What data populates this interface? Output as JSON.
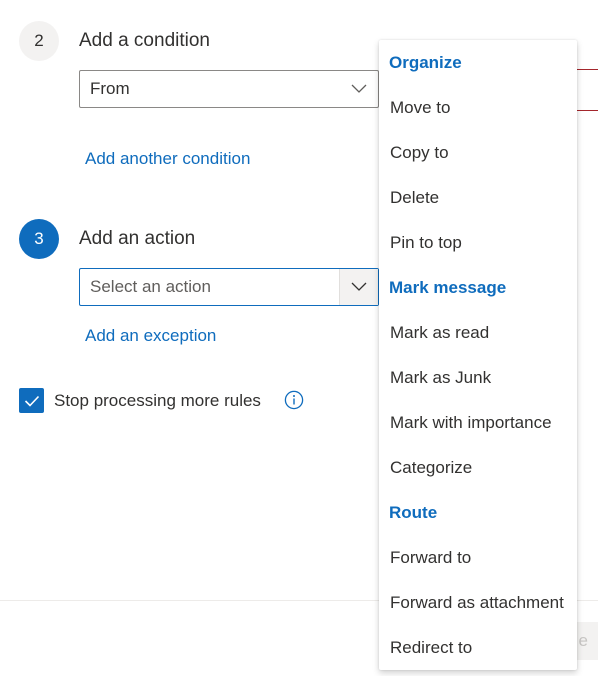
{
  "step2": {
    "number": "2",
    "title": "Add a condition",
    "dropdown_value": "From",
    "add_link": "Add another condition"
  },
  "step3": {
    "number": "3",
    "title": "Add an action",
    "dropdown_placeholder": "Select an action",
    "exception_link": "Add an exception"
  },
  "stop_processing": {
    "label": "Stop processing more rules",
    "checked": true
  },
  "footer": {
    "partial_button_label": "e"
  },
  "action_menu": {
    "groups": [
      {
        "header": "Organize",
        "items": [
          "Move to",
          "Copy to",
          "Delete",
          "Pin to top"
        ]
      },
      {
        "header": "Mark message",
        "items": [
          "Mark as read",
          "Mark as Junk",
          "Mark with importance",
          "Categorize"
        ]
      },
      {
        "header": "Route",
        "items": [
          "Forward to",
          "Forward as attachment",
          "Redirect to"
        ]
      }
    ]
  },
  "colors": {
    "accent": "#0f6cbd",
    "text": "#323130",
    "error_line": "#a4262c"
  },
  "icons": {
    "chevron": "chevron-down-icon",
    "check": "checkmark-icon",
    "info": "info-icon"
  }
}
